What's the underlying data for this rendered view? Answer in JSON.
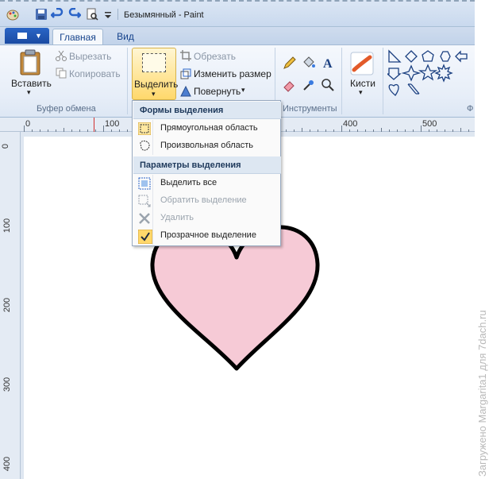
{
  "titlebar": {
    "title": "Безымянный - Paint"
  },
  "tabs": {
    "file_menu": "file-menu",
    "home": "Главная",
    "view": "Вид"
  },
  "ribbon": {
    "clipboard": {
      "paste": "Вставить",
      "cut": "Вырезать",
      "copy": "Копировать",
      "group": "Буфер обмена"
    },
    "image": {
      "select": "Выделить",
      "crop": "Обрезать",
      "resize": "Изменить размер",
      "rotate": "Повернуть"
    },
    "tools": {
      "group": "Инструменты"
    },
    "brushes": {
      "label": "Кисти"
    },
    "shapes": {
      "group_short": "Ф"
    }
  },
  "ruler": {
    "h_labels": [
      "0",
      "100",
      "400",
      "500"
    ],
    "v_labels": [
      "0",
      "100",
      "200",
      "300",
      "400"
    ]
  },
  "dropdown": {
    "section1": "Формы выделения",
    "rect": "Прямоугольная область",
    "free": "Произвольная область",
    "section2": "Параметры выделения",
    "select_all": "Выделить все",
    "invert": "Обратить выделение",
    "delete": "Удалить",
    "transparent": "Прозрачное выделение",
    "transparent_checked": true
  },
  "watermark": "Загружено Margarita1 для 7dach.ru",
  "colors": {
    "heart_fill": "#f6cad6",
    "heart_stroke": "#000000",
    "accent": "#ffd86b"
  }
}
